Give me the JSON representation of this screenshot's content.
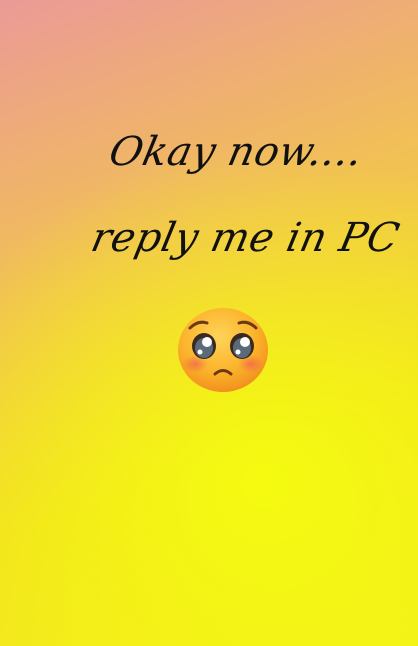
{
  "caption": {
    "line1": "Okay now....",
    "line2": "reply me in PC"
  },
  "emoji": {
    "name": "pleading-face-icon",
    "face_color": "#fbb22a",
    "blush_color": "#f26a4b"
  },
  "colors": {
    "background_top": "#eb9a97",
    "background_bottom": "#f3ef1c",
    "text": "#111111"
  }
}
